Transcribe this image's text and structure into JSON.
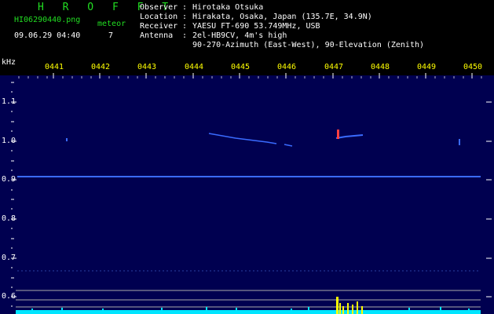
{
  "header": {
    "title": "H R O F F T",
    "filename": "HI06290440.png",
    "meteor_label": "meteor",
    "timestamp": "09.06.29 04:40",
    "meteor_count": "7",
    "info": [
      {
        "label": "Observer",
        "value": "Hirotaka Otsuka"
      },
      {
        "label": "Location",
        "value": "Hirakata, Osaka, Japan (135.7E, 34.9N)"
      },
      {
        "label": "Receiver",
        "value": "YAESU FT-690 53.749MHz, USB"
      },
      {
        "label": "Antenna",
        "value": "2el-HB9CV, 4m's high"
      },
      {
        "label": "",
        "value": "90-270-Azimuth (East-West), 90-Elevation (Zenith)"
      }
    ]
  },
  "axis": {
    "y_unit": "kHz",
    "y_ticks": [
      "1.1",
      "1.0",
      "0.9",
      "0.8",
      "0.7",
      "0.6"
    ],
    "x_ticks": [
      "0441",
      "0442",
      "0443",
      "0444",
      "0445",
      "0446",
      "0447",
      "0448",
      "0449",
      "0450"
    ]
  },
  "colors": {
    "background": "#000000",
    "plot_bg": "#000050",
    "trace": "#3a6bff",
    "meteor_head": "#ff4040",
    "spectrum": "#00e5ff",
    "spectrum_peak": "#ffff00",
    "header_green": "#22dd22"
  }
}
